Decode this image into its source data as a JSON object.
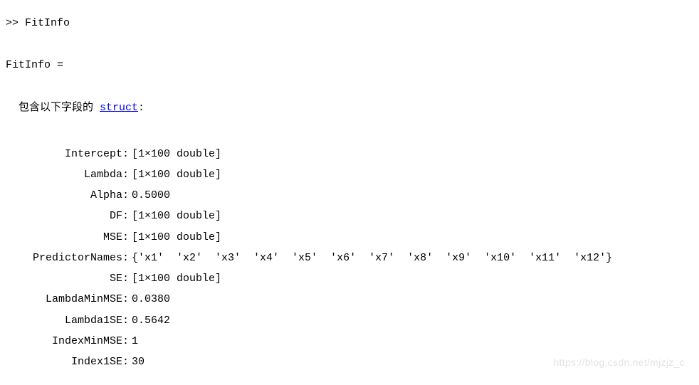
{
  "prompt": ">> FitInfo",
  "result_header": "FitInfo =",
  "struct_intro_prefix": "  包含以下字段的 ",
  "struct_link": "struct",
  "struct_intro_suffix": ":",
  "fields": [
    {
      "name": "Intercept",
      "value": "[1×100 double]"
    },
    {
      "name": "Lambda",
      "value": "[1×100 double]"
    },
    {
      "name": "Alpha",
      "value": "0.5000"
    },
    {
      "name": "DF",
      "value": "[1×100 double]"
    },
    {
      "name": "MSE",
      "value": "[1×100 double]"
    },
    {
      "name": "PredictorNames",
      "value": "{'x1'  'x2'  'x3'  'x4'  'x5'  'x6'  'x7'  'x8'  'x9'  'x10'  'x11'  'x12'}"
    },
    {
      "name": "SE",
      "value": "[1×100 double]"
    },
    {
      "name": "LambdaMinMSE",
      "value": "0.0380"
    },
    {
      "name": "Lambda1SE",
      "value": "0.5642"
    },
    {
      "name": "IndexMinMSE",
      "value": "1"
    },
    {
      "name": "Index1SE",
      "value": "30"
    }
  ],
  "watermark": "https://blog.csdn.net/mjzjz_c"
}
